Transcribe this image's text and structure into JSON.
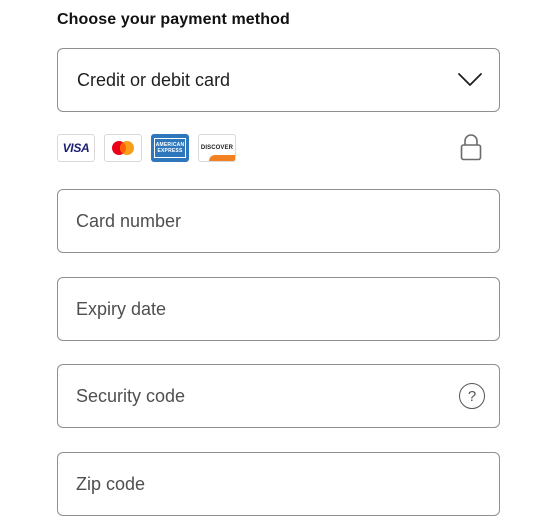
{
  "heading": "Choose your payment method",
  "payment_select": {
    "value": "Credit or debit card",
    "icon": "chevron-down-icon"
  },
  "card_logos": {
    "visa": "VISA",
    "mastercard": "mastercard-logo",
    "amex_line1": "AMERICAN",
    "amex_line2": "EXPRESS",
    "discover": "DISCOVER"
  },
  "lock_icon": "lock-icon",
  "fields": {
    "card_number": {
      "placeholder": "Card number",
      "value": ""
    },
    "expiry_date": {
      "placeholder": "Expiry date",
      "value": ""
    },
    "security_code": {
      "placeholder": "Security code",
      "value": "",
      "help_icon": "?"
    },
    "zip_code": {
      "placeholder": "Zip code",
      "value": ""
    }
  },
  "colors": {
    "border": "#8f8f8f",
    "text": "#1f1f1f",
    "visa_blue": "#1a1f71",
    "mc_red": "#eb001b",
    "mc_orange": "#f79e1b",
    "amex_blue": "#2e77bc",
    "discover_orange": "#f48120"
  }
}
